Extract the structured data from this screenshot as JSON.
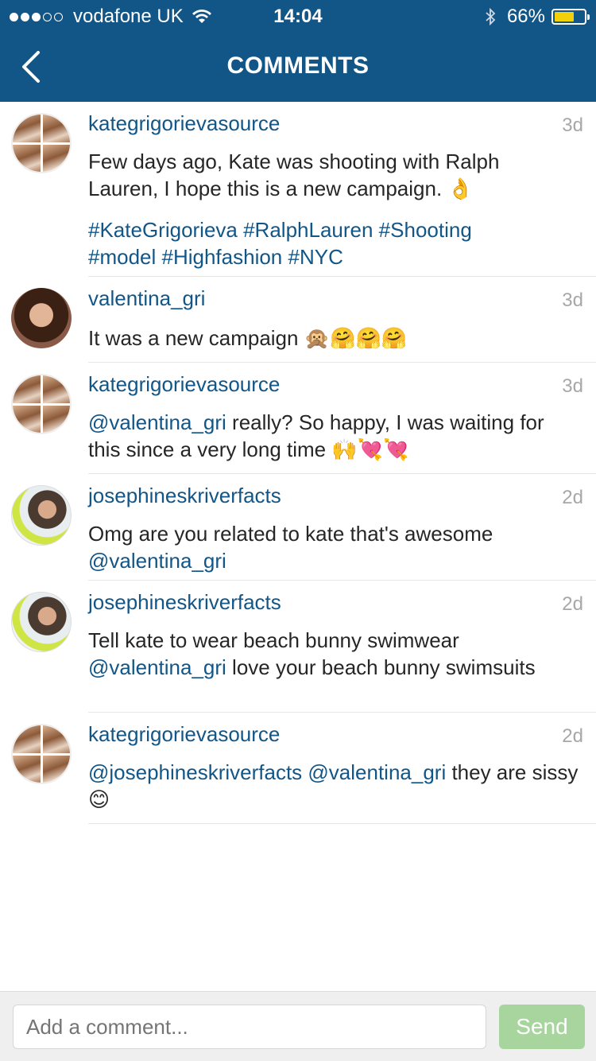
{
  "status_bar": {
    "carrier": "vodafone UK",
    "time": "14:04",
    "battery": "66%",
    "battery_level": 0.66,
    "signal_bars_filled": 3,
    "signal_bars_total": 5
  },
  "header": {
    "title": "COMMENTS",
    "back_icon": "chevron-left-icon",
    "background_color": "#125688"
  },
  "comments": [
    {
      "username": "kategrigorievasource",
      "age": "3d",
      "text": "Few days ago, Kate was shooting with Ralph Lauren, I hope this is a new campaign. 👌",
      "hashtags": "#KateGrigorieva #RalphLauren #Shooting #model #Highfashion #NYC"
    },
    {
      "username": "valentina_gri",
      "age": "3d",
      "text": "It was a new campaign 🙊🤗🤗🤗"
    },
    {
      "username": "kategrigorievasource",
      "age": "3d",
      "mention": "@valentina_gri",
      "text": " really? So happy, I was waiting for this since a very long time 🙌💘💘"
    },
    {
      "username": "josephineskriverfacts",
      "age": "2d",
      "text": "Omg are you related to kate that's awesome ",
      "mention": "@valentina_gri"
    },
    {
      "username": "josephineskriverfacts",
      "age": "2d",
      "text": "Tell kate to wear beach bunny swimwear ",
      "mention": "@valentina_gri",
      "text_after": " love your beach bunny swimsuits"
    },
    {
      "username": "kategrigorievasource",
      "age": "2d",
      "mention": "@josephineskriverfacts @valentina_gri",
      "text": " they are sissy 😊"
    }
  ],
  "composer": {
    "placeholder": "Add a comment...",
    "send_label": "Send",
    "send_color": "#a8d59d"
  }
}
